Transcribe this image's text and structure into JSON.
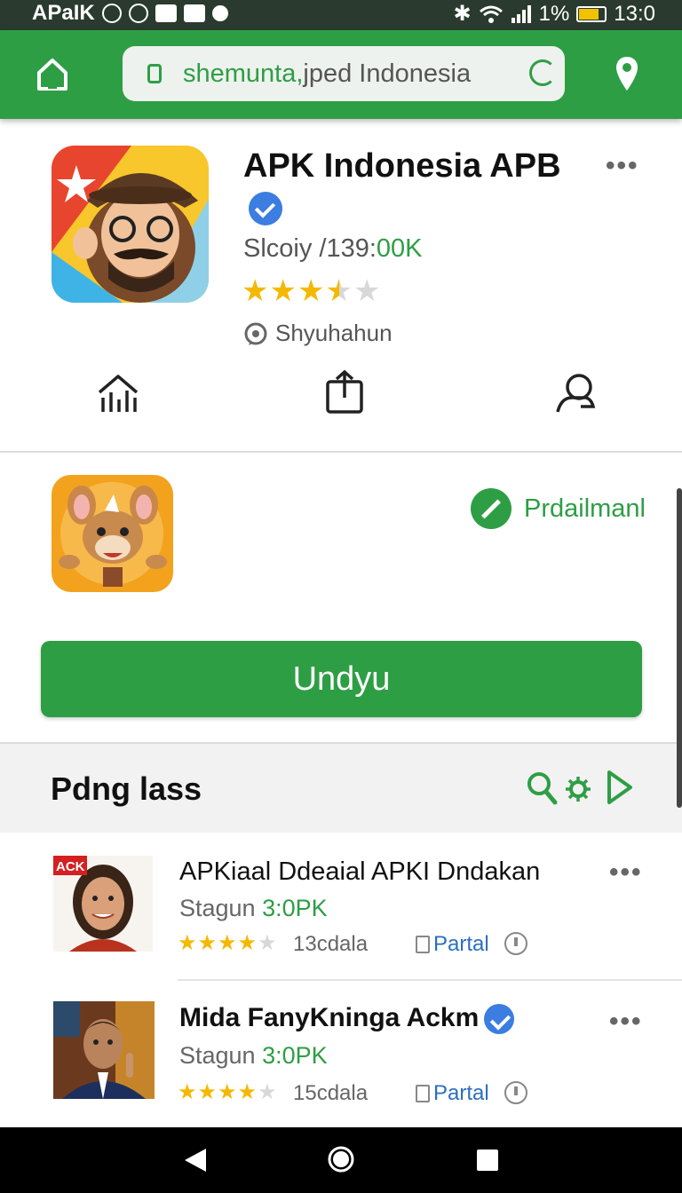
{
  "status_bar": {
    "carrier": "APaIK",
    "battery": "1%",
    "time": "13:0"
  },
  "browser": {
    "url_green": "shemunta,",
    "url_grey": "jped Indonesia"
  },
  "app": {
    "title": "APK Indonesia APB",
    "version_prefix": "Slcoiy /139:",
    "version_value": "00K",
    "rating": 3.5,
    "publisher": "Shyuhahun"
  },
  "second_app": {
    "badge_label": "Prdailmanl"
  },
  "download_button": "Undyu",
  "section": {
    "title": "Pdng lass"
  },
  "list": [
    {
      "thumb_label": "ACK",
      "title": "APKiaal Ddeaial APKI Dndakan",
      "sub_prefix": "Stagun ",
      "sub_value": "3:0PK",
      "rating": 4,
      "count": "13cdala",
      "tag": "Partal"
    },
    {
      "thumb_label": "",
      "title": "Mida FanyKninga Ackm",
      "sub_prefix": "Stagun ",
      "sub_value": "3:0PK",
      "rating": 4,
      "count": "15cdala",
      "tag": "Partal"
    }
  ],
  "colors": {
    "brand_green": "#2e9e45",
    "verified_blue": "#3b7de0",
    "star": "#f5b800"
  }
}
